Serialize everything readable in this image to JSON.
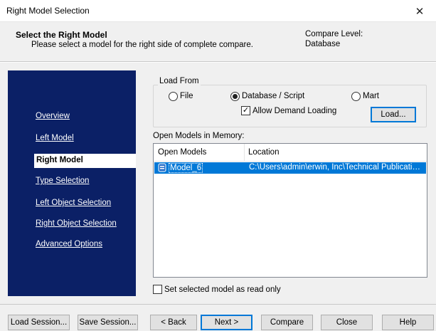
{
  "window": {
    "title": "Right Model Selection"
  },
  "header": {
    "title": "Select the Right Model",
    "subtitle": "Please select a model for the right side of complete compare.",
    "compare_level_label": "Compare Level:",
    "compare_level_value": "Database"
  },
  "nav": {
    "items": [
      {
        "label": "Overview"
      },
      {
        "label": "Left Model"
      },
      {
        "label": "Right Model",
        "selected": true
      },
      {
        "label": "Type Selection"
      },
      {
        "label": "Left Object Selection"
      },
      {
        "label": "Right Object Selection"
      },
      {
        "label": "Advanced Options"
      }
    ]
  },
  "load_from": {
    "title": "Load From",
    "options": [
      {
        "label": "File",
        "checked": false
      },
      {
        "label": "Database / Script",
        "checked": true
      },
      {
        "label": "Mart",
        "checked": false
      }
    ],
    "allow_demand_loading": {
      "label": "Allow Demand Loading",
      "checked": true
    },
    "load_button": "Load..."
  },
  "models": {
    "label": "Open Models in Memory:",
    "columns": [
      "Open Models",
      "Location"
    ],
    "rows": [
      {
        "name": "Model_6",
        "location": "C:\\Users\\admin\\erwin, Inc\\Technical Publications\\...",
        "selected": true
      }
    ]
  },
  "read_only": {
    "label": "Set selected model as read only",
    "checked": false
  },
  "footer": {
    "load_session": "Load Session...",
    "save_session": "Save Session...",
    "back": "< Back",
    "next": "Next >",
    "compare": "Compare",
    "close": "Close",
    "help": "Help"
  },
  "icons": {
    "close": "close-icon",
    "model": "model-icon"
  },
  "colors": {
    "nav_bg": "#0b2066",
    "selection": "#0078d7"
  }
}
